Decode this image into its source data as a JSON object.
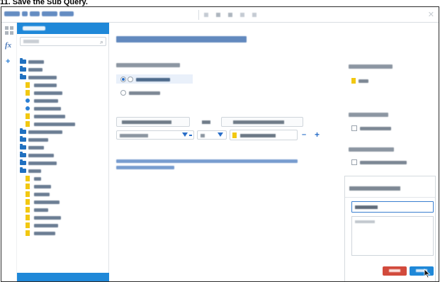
{
  "caption": {
    "text": "11. Save the Sub Query."
  },
  "window": {
    "breadcrumb": "(illegible)",
    "toolbar_icons": [
      "undo-icon",
      "align-icon",
      "text-icon",
      "back-icon",
      "forward-icon"
    ]
  },
  "sidebar": {
    "header": "(illegible)",
    "search_placeholder": "(illegible)",
    "icons": [
      "grid-icon",
      "formula-icon",
      "add-icon"
    ]
  },
  "tree": {
    "nodes": [
      {
        "kind": "folder",
        "level": 0
      },
      {
        "kind": "folder",
        "level": 0
      },
      {
        "kind": "folder",
        "level": 0
      },
      {
        "kind": "field",
        "level": 1
      },
      {
        "kind": "field",
        "level": 1
      },
      {
        "kind": "dot",
        "level": 1
      },
      {
        "kind": "dot",
        "level": 1
      },
      {
        "kind": "field",
        "level": 1
      },
      {
        "kind": "field",
        "level": 1
      },
      {
        "kind": "folder",
        "level": 0
      },
      {
        "kind": "folder",
        "level": 0
      },
      {
        "kind": "folder",
        "level": 0
      },
      {
        "kind": "folder",
        "level": 0
      },
      {
        "kind": "folder",
        "level": 0
      },
      {
        "kind": "folder",
        "level": 0
      },
      {
        "kind": "field",
        "level": 1
      },
      {
        "kind": "field",
        "level": 1
      },
      {
        "kind": "field",
        "level": 1
      },
      {
        "kind": "field",
        "level": 1
      },
      {
        "kind": "field",
        "level": 1
      },
      {
        "kind": "field",
        "level": 1
      },
      {
        "kind": "field",
        "level": 1
      },
      {
        "kind": "field",
        "level": 1
      }
    ]
  },
  "main": {
    "title": "(illegible)",
    "query_type_label": "(illegible)",
    "options": [
      {
        "label": "(illegible)",
        "selected": true
      },
      {
        "label": "(illegible)",
        "selected": false
      }
    ],
    "primary_header": "(illegible)",
    "operator_header": "(illegible)",
    "subquery_header": "(illegible)",
    "primary_value": "(illegible)",
    "operator_value": "(illegible)",
    "subquery_field": "(illegible)",
    "help_text": "(illegible)",
    "right": {
      "fields_label": "(illegible)",
      "field_item": "(illegible)",
      "option_label": "(illegible)",
      "option_check": "(illegible)",
      "prompt_label": "(illegible)",
      "prompt_check": "(illegible)",
      "name_desc_title": "(illegible)",
      "name_value": "(illegible)",
      "description_placeholder": "(illegible)"
    },
    "buttons": {
      "delete": "(illegible)",
      "save": "(illegible)"
    }
  },
  "colors": {
    "accent": "#1f88d8",
    "danger": "#d24a3c",
    "field": "#f2c811",
    "folder": "#2070c0"
  }
}
